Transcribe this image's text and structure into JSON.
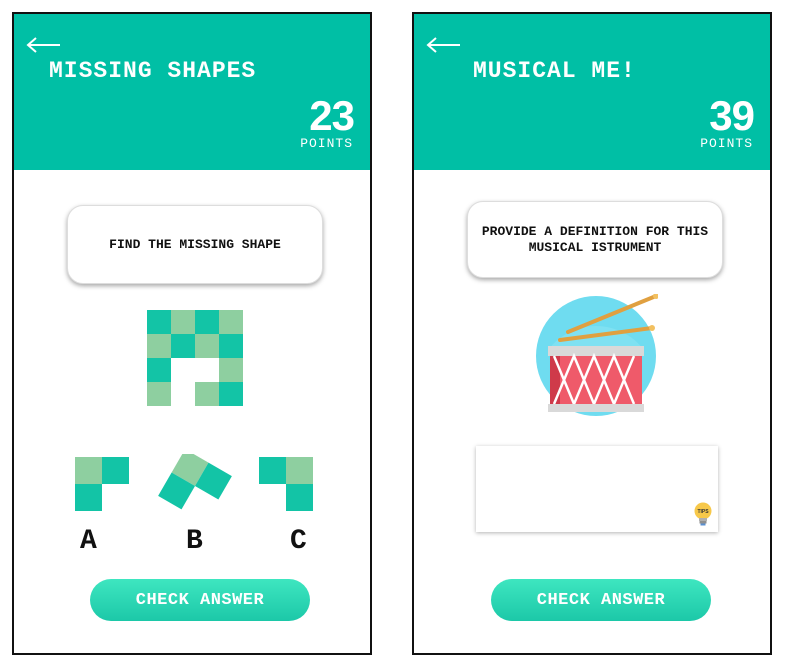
{
  "screens": [
    {
      "title": "MISSING SHAPES",
      "score": "23",
      "points_label": "POINTS",
      "prompt": "FIND THE MISSING SHAPE",
      "options": [
        "A",
        "B",
        "C"
      ],
      "button_label": "CHECK ANSWER"
    },
    {
      "title": "MUSICAL ME!",
      "score": "39",
      "points_label": "POINTS",
      "prompt": "PROVIDE A DEFINITION FOR THIS MUSICAL ISTRUMENT",
      "answer_value": "",
      "tip_label": "TIPS",
      "button_label": "CHECK ANSWER"
    }
  ],
  "colors": {
    "accent": "#00bfa5",
    "tile_dark": "#13c4a6",
    "tile_light": "#8ecfa0",
    "button": "#2dd8b4"
  },
  "icons": [
    "back-arrow-icon",
    "drum-icon",
    "lightbulb-tips-icon"
  ]
}
